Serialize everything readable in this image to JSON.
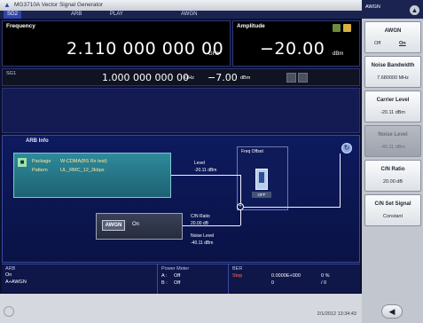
{
  "window": {
    "title": "MG3710A  Vector Signal Generator"
  },
  "tabs": [
    {
      "label": "SG2",
      "active": true
    },
    {
      "label": "ARB"
    },
    {
      "label": "PLAY"
    },
    {
      "label": "AWGN"
    }
  ],
  "frequency": {
    "label": "Frequency",
    "value": "2.110 000 000 00",
    "unit": "GHz"
  },
  "amplitude": {
    "label": "Amplitude",
    "value": "−20.00",
    "unit": "dBm"
  },
  "sg1": {
    "label": "SG1",
    "freq_value": "1.000 000 000 00",
    "freq_unit": "GHz",
    "amp_value": "−7.00",
    "amp_unit": "dBm"
  },
  "arb_info": {
    "title": "ARB Info",
    "package_label": "Package",
    "package_value": "W-CDMA(BS Rx test)",
    "pattern_label": "Pattern",
    "pattern_value": "UL_RMC_12_2kbps",
    "level_label": "Level",
    "level_value": "-20.11 dBm",
    "freq_offset_label": "Freq Offset",
    "freq_offset_value": "OFF",
    "awgn_label": "AWGN",
    "awgn_state": "On",
    "cn_ratio_label": "C/N Ratio",
    "cn_ratio_value": "20.00 dB",
    "noise_level_label": "Noise Level",
    "noise_level_value": "-40.11 dBm"
  },
  "status": {
    "arb": {
      "title": "ARB",
      "line1": "On",
      "line2": "A+AWGN"
    },
    "power_meter": {
      "title": "Power Meter",
      "a_label": "A :",
      "a_value": "Off",
      "b_label": "B :",
      "b_value": "Off"
    },
    "ber": {
      "title": "BER",
      "state": "Stop",
      "value1": "0.0000E+000",
      "value2": "0 %",
      "value3": "0",
      "value4": "/ 0"
    }
  },
  "datetime": "2/1/2012 13:34:43",
  "side_panel": {
    "title": "AWGN",
    "softkeys": [
      {
        "title": "AWGN",
        "options": [
          "Off",
          "On"
        ],
        "selected": "On"
      },
      {
        "title": "Noise Bandwidth",
        "value": "7.680000 MHz"
      },
      {
        "title": "Carrier Level",
        "value": "-20.11 dBm"
      },
      {
        "title": "Noise Level",
        "value": "-40.11 dBm",
        "disabled": true
      },
      {
        "title": "C/N Ratio",
        "value": "20.00 dB"
      },
      {
        "title": "C/N Set Signal",
        "value": "Constant"
      }
    ]
  },
  "colors": {
    "accent": "#3046a8",
    "display_bg": "#0b0f2e",
    "package_box": "#2e8a9a"
  }
}
